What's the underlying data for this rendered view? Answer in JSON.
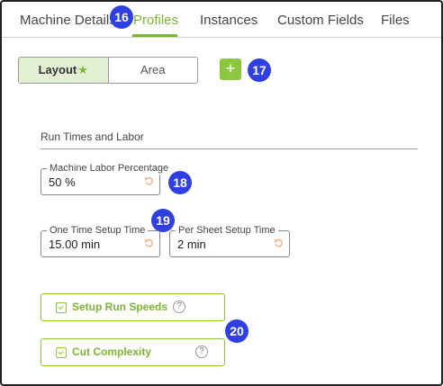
{
  "tabs": [
    {
      "label": "Machine Details",
      "active": false
    },
    {
      "label": "Profiles",
      "active": true
    },
    {
      "label": "Instances",
      "active": false
    },
    {
      "label": "Custom Fields",
      "active": false
    },
    {
      "label": "Files",
      "active": false
    }
  ],
  "segmented": {
    "layout_label": "Layout",
    "area_label": "Area",
    "selected": "Layout"
  },
  "add_button": {
    "symbol": "+"
  },
  "section": {
    "title": "Run Times and Labor"
  },
  "fields": {
    "labor": {
      "label": "Machine Labor Percentage",
      "value": "50 %"
    },
    "setup": {
      "label": "One Time Setup Time",
      "value": "15.00 min"
    },
    "per_sheet": {
      "label": "Per Sheet Setup Time",
      "value": "2 min"
    }
  },
  "buttons": {
    "run_speeds": {
      "label": "Setup Run Speeds",
      "help": "?"
    },
    "cut_complexity": {
      "label": "Cut Complexity",
      "help": "?"
    }
  },
  "badges": [
    "16",
    "17",
    "18",
    "19",
    "20"
  ],
  "colors": {
    "accent": "#7bb534",
    "accent_btn": "#8cc63f",
    "badge": "#2f3fe0"
  }
}
